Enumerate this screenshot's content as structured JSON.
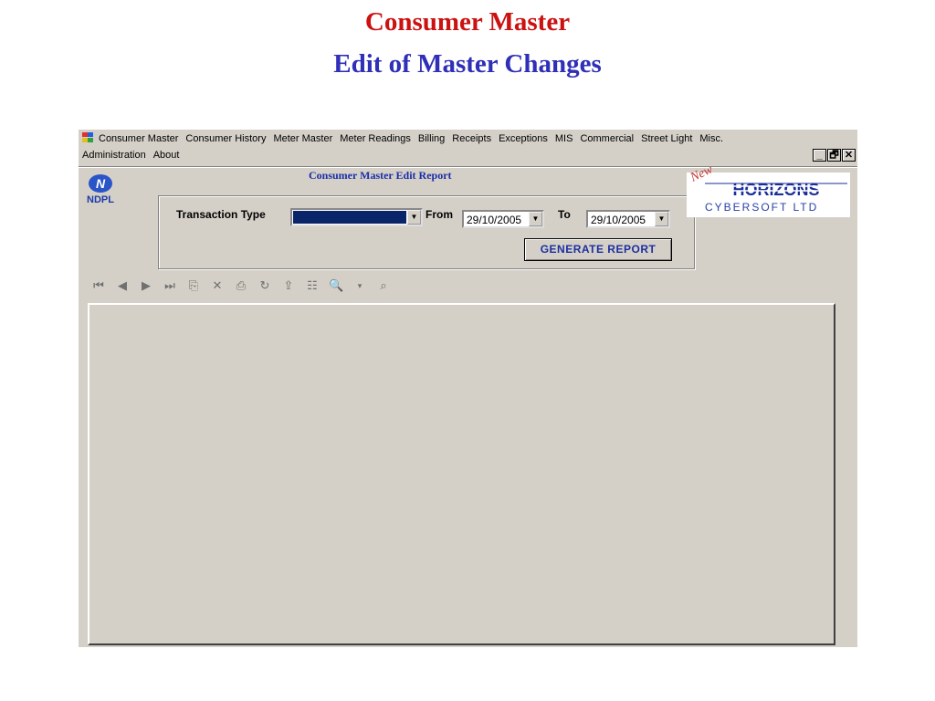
{
  "slide": {
    "title": "Consumer Master",
    "subtitle": "Edit of Master Changes"
  },
  "menu": {
    "row1": [
      "Consumer Master",
      "Consumer History",
      "Meter Master",
      "Meter Readings",
      "Billing",
      "Receipts",
      "Exceptions",
      "MIS",
      "Commercial",
      "Street Light",
      "Misc."
    ],
    "row2": [
      "Administration",
      "About"
    ]
  },
  "window_controls": {
    "minimize": "_",
    "restore": "🗗",
    "close": "✕"
  },
  "report": {
    "title": "Consumer Master  Edit Report"
  },
  "ndpl_logo": {
    "text": "NDPL",
    "icon": "ndpl-logo-icon"
  },
  "filters": {
    "transaction_type_label": "Transaction Type",
    "transaction_type_value": "",
    "from_label": "From",
    "from_value": "29/10/2005",
    "to_label": "To",
    "to_value": "29/10/2005"
  },
  "buttons": {
    "generate": "GENERATE REPORT"
  },
  "vendor_logo": {
    "new": "New",
    "brand": "HORIZONS",
    "sub": "CYBERSOFT LTD"
  },
  "toolbar_icons": [
    "first-page-icon",
    "prev-page-icon",
    "next-page-icon",
    "last-page-icon",
    "goto-page-icon",
    "close-icon",
    "print-icon",
    "refresh-icon",
    "export-icon",
    "group-tree-icon",
    "zoom-icon",
    "dropdown-arrow-icon",
    "search-icon"
  ],
  "colors": {
    "title_red": "#cc1111",
    "title_blue": "#2f2fb8",
    "selection_navy": "#0a246a",
    "window_bg": "#d4d0c8"
  }
}
